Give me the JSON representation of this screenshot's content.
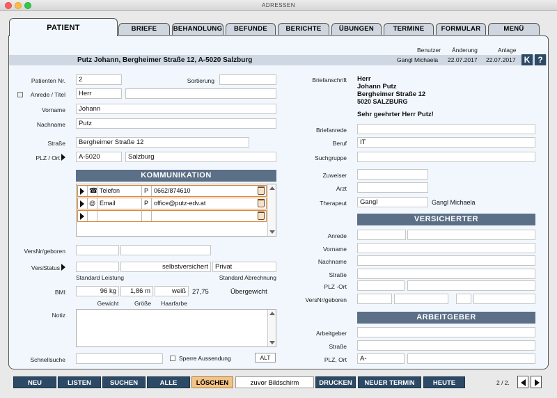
{
  "window": {
    "title": "ADRESSEN"
  },
  "tabs": [
    {
      "label": "Patient",
      "active": true
    },
    {
      "label": "Briefe"
    },
    {
      "label": "Behandlung"
    },
    {
      "label": "Befunde"
    },
    {
      "label": "Berichte"
    },
    {
      "label": "Übungen"
    },
    {
      "label": "Termine"
    },
    {
      "label": "Formular"
    },
    {
      "label": "Menü"
    }
  ],
  "header": {
    "col_benutzer": "Benutzer",
    "col_aenderung": "Änderung",
    "col_anlage": "Anlage",
    "patient_summary": "Putz Johann, Bergheimer Straße 12, A-5020 Salzburg",
    "benutzer": "Gangl Michaela",
    "aenderung": "22.07.2017",
    "anlage": "22.07.2017",
    "btn_k": "K",
    "btn_help": "?"
  },
  "patient": {
    "nr_label": "Patienten Nr.",
    "nr": "2",
    "sortierung_label": "Sortierung",
    "sortierung": "",
    "anrede_label": "Anrede / Titel",
    "anrede": "Herr",
    "titel": "",
    "vorname_label": "Vorname",
    "vorname": "Johann",
    "nachname_label": "Nachname",
    "nachname": "Putz",
    "strasse_label": "Straße",
    "strasse": "Bergheimer Straße 12",
    "plz_label": "PLZ / Ort",
    "plz": "A-5020",
    "ort": "Salzburg"
  },
  "kommunikation": {
    "title": "KOMMUNIKATION",
    "rows": [
      {
        "type": "Telefon",
        "flag": "P",
        "value": "0662/874610"
      },
      {
        "type": "Email",
        "flag": "P",
        "value": "office@putz-edv.at"
      },
      {
        "type": "",
        "flag": "",
        "value": ""
      }
    ]
  },
  "versicherung": {
    "versnr_label": "VersNr/geboren",
    "versnr": "",
    "geboren": "",
    "status_label": "VersStatus",
    "status": "",
    "status_text": "selbstversichert",
    "abrechnung": "Privat",
    "std_leistung": "Standard Leistung",
    "std_abrechnung": "Standard Abrechnung"
  },
  "bmi": {
    "label": "BMI",
    "gewicht": "96 kg",
    "groesse": "1,86 m",
    "haarfarbe": "weiß",
    "value": "27,75",
    "category": "Übergewicht",
    "gewicht_label": "Gewicht",
    "groesse_label": "Größe",
    "haarfarbe_label": "Haarfarbe"
  },
  "notiz": {
    "label": "Notiz",
    "value": ""
  },
  "schnellsuche": {
    "label": "Schnellsuche",
    "value": "",
    "sperre_label": "Sperre Aussendung",
    "alt_label": "ALT"
  },
  "brief": {
    "label": "Briefanschrift",
    "lines": [
      "Herr",
      "Johann Putz",
      "Bergheimer Straße 12",
      "5020 SALZBURG"
    ],
    "salutation": "Sehr geehrter Herr Putz!",
    "briefanrede_label": "Briefanrede",
    "briefanrede": "",
    "beruf_label": "Beruf",
    "beruf": "IT",
    "suchgruppe_label": "Suchgruppe",
    "suchgruppe": ""
  },
  "zuweisung": {
    "zuweiser_label": "Zuweiser",
    "zuweiser": "",
    "arzt_label": "Arzt",
    "arzt": "",
    "therapeut_label": "Therapeut",
    "therapeut": "Gangl",
    "therapeut_full": "Gangl Michaela"
  },
  "versicherter": {
    "title": "VERSICHERTER",
    "anrede_label": "Anrede",
    "vorname_label": "Vorname",
    "nachname_label": "Nachname",
    "strasse_label": "Straße",
    "plz_label": "PLZ -Ort",
    "versnr_label": "VersNr/geboren"
  },
  "arbeitgeber": {
    "title": "ARBEITGEBER",
    "arbeitgeber_label": "Arbeitgeber",
    "strasse_label": "Straße",
    "plz_label": "PLZ, Ort",
    "plz": "A-",
    "ort": ""
  },
  "bottom": {
    "neu": "NEU",
    "listen": "LISTEN",
    "suchen": "SUCHEN",
    "alle": "ALLE",
    "loeschen": "LÖSCHEN",
    "zuvor": "zuvor Bildschirm",
    "drucken": "DRUCKEN",
    "neuer_termin": "NEUER TERMIN",
    "heute": "HEUTE",
    "pager": "2 / 2."
  },
  "colors": {
    "accent": "#2c4a66",
    "section": "#5b6f86",
    "highlight": "#f4c486",
    "panel": "#f1f7fd"
  }
}
